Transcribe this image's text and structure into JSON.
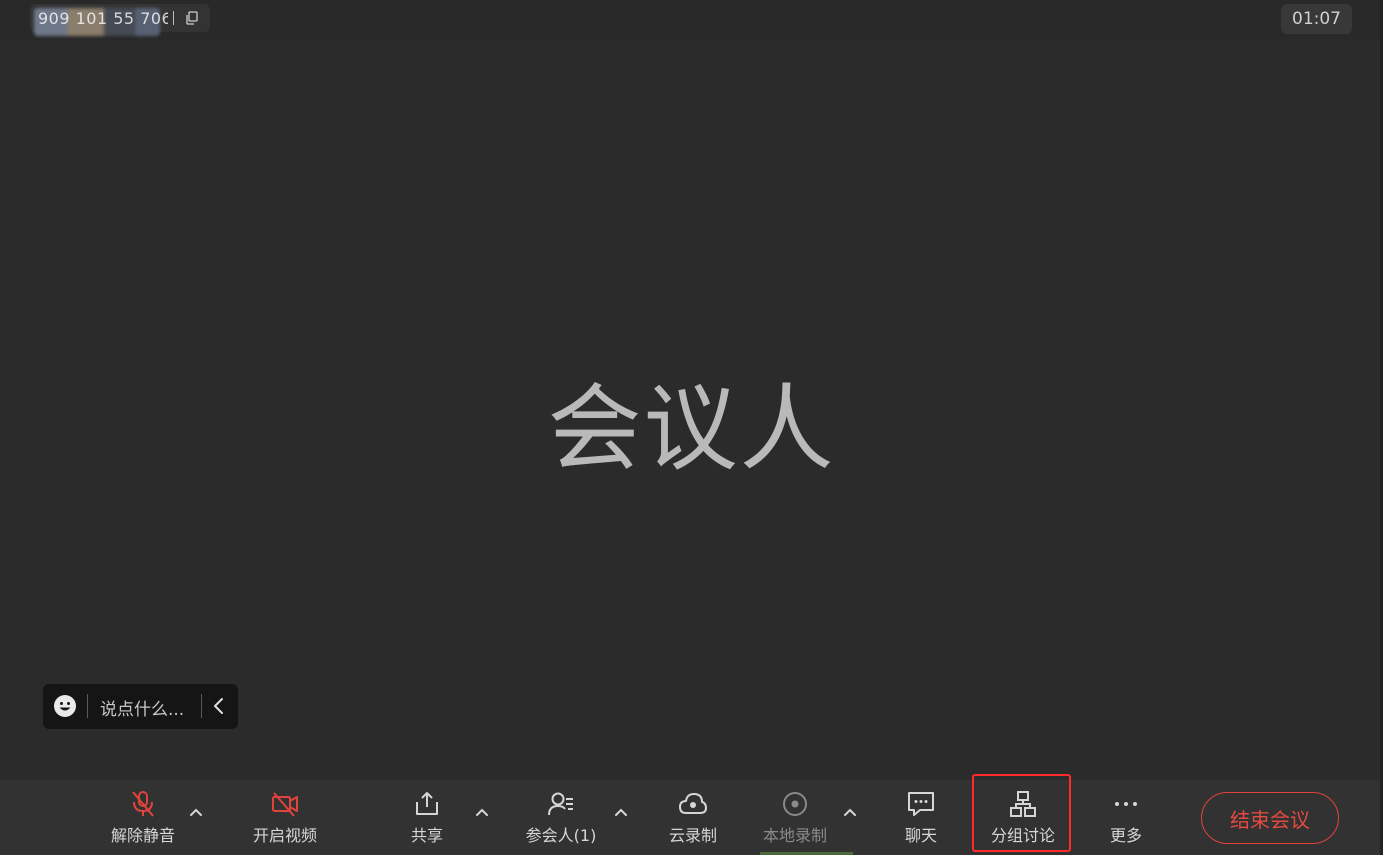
{
  "topbar": {
    "meeting_id": "909 101 55 706",
    "timer": "01:07"
  },
  "main": {
    "participant_name": "会议人"
  },
  "chat": {
    "placeholder": "说点什么..."
  },
  "toolbar": {
    "unmute_label": "解除静音",
    "start_video_label": "开启视频",
    "share_label": "共享",
    "participants_label": "参会人(1)",
    "cloud_record_label": "云录制",
    "local_record_label": "本地录制",
    "chat_label": "聊天",
    "breakout_label": "分组讨论",
    "more_label": "更多",
    "end_meeting_label": "结束会议"
  },
  "colors": {
    "background": "#2b2b2b",
    "toolbar": "#323232",
    "muted_red": "#e0443c",
    "highlight_red": "#ff2a2a",
    "text": "#d6d6d6"
  }
}
